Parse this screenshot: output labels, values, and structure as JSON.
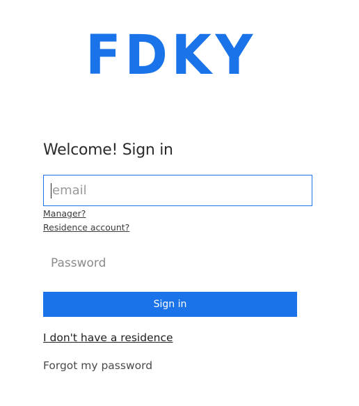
{
  "logo": {
    "text": "FDKY"
  },
  "form": {
    "heading": "Welcome! Sign in",
    "email": {
      "value": "",
      "placeholder": "email"
    },
    "links": {
      "manager": "Manager?",
      "residence_account": "Residence account?"
    },
    "password": {
      "value": "",
      "placeholder": "Password"
    },
    "submit_label": "Sign in",
    "no_residence_link": "I don't have a residence",
    "forgot_password": "Forgot my password"
  },
  "colors": {
    "accent": "#1a73e8",
    "text": "#2b2b2b",
    "placeholder": "#9a9a9a"
  }
}
